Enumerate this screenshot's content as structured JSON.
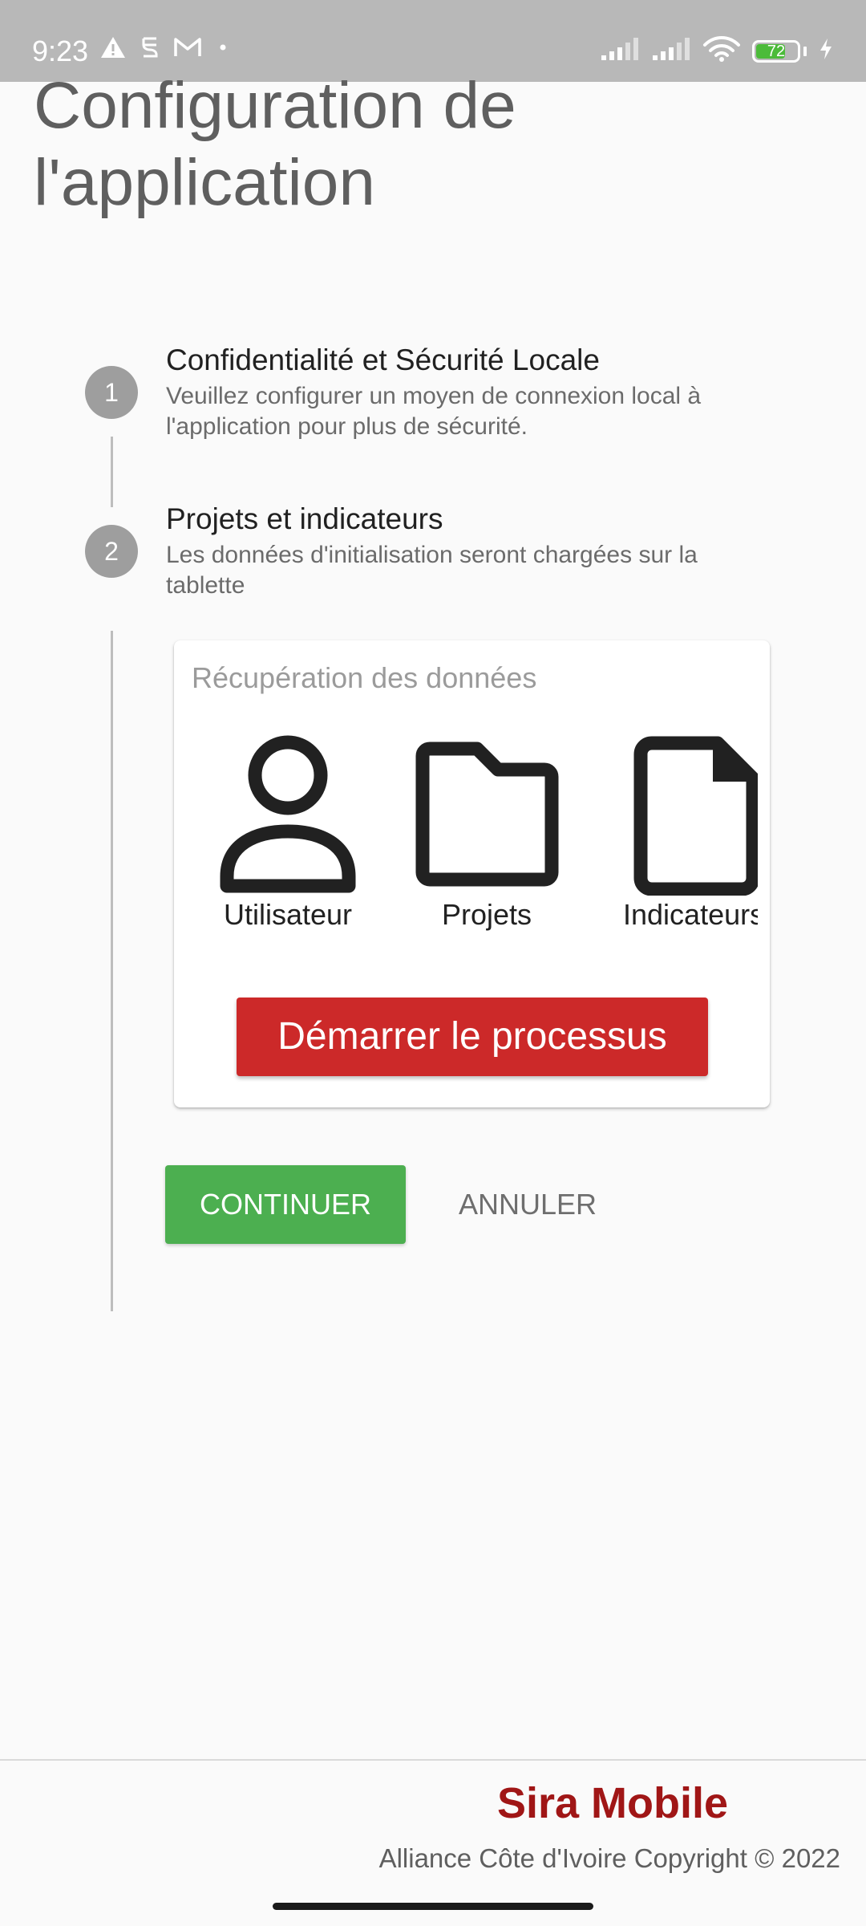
{
  "status_bar": {
    "time": "9:23",
    "battery_level": "72",
    "battery_fraction": 0.72,
    "colors": {
      "background": "#b8b8b8",
      "battery_fill": "#4cbb3a"
    },
    "icons": [
      "warning-icon",
      "notification-icon",
      "gmail-icon",
      "dot-icon",
      "signal-icon",
      "signal-icon",
      "wifi-icon",
      "battery-icon",
      "charging-icon"
    ]
  },
  "page": {
    "title": "Configuration de l'application"
  },
  "stepper": {
    "steps": [
      {
        "number": "1",
        "title": "Confidentialité et Sécurité Locale",
        "description": "Veuillez configurer un moyen de connexion local à l'application pour plus de sécurité."
      },
      {
        "number": "2",
        "title": "Projets et indicateurs",
        "description": "Les données d'initialisation seront chargées sur la tablette"
      }
    ]
  },
  "data_card": {
    "title": "Récupération des données",
    "items": [
      {
        "label": "Utilisateur",
        "icon": "user-icon"
      },
      {
        "label": "Projets",
        "icon": "folder-icon"
      },
      {
        "label": "Indicateurs",
        "icon": "file-icon"
      }
    ],
    "start_button_label": "Démarrer le processus"
  },
  "actions": {
    "continue_label": "CONTINUER",
    "cancel_label": "ANNULER"
  },
  "footer": {
    "brand": "Sira Mobile",
    "copyright": "Alliance Côte d'Ivoire Copyright © 2022"
  },
  "colors": {
    "primary_red": "#cc2929",
    "brand_red": "#a01616",
    "continue_green": "#4caf50",
    "step_grey": "#9e9e9e",
    "background": "#fafafa"
  }
}
